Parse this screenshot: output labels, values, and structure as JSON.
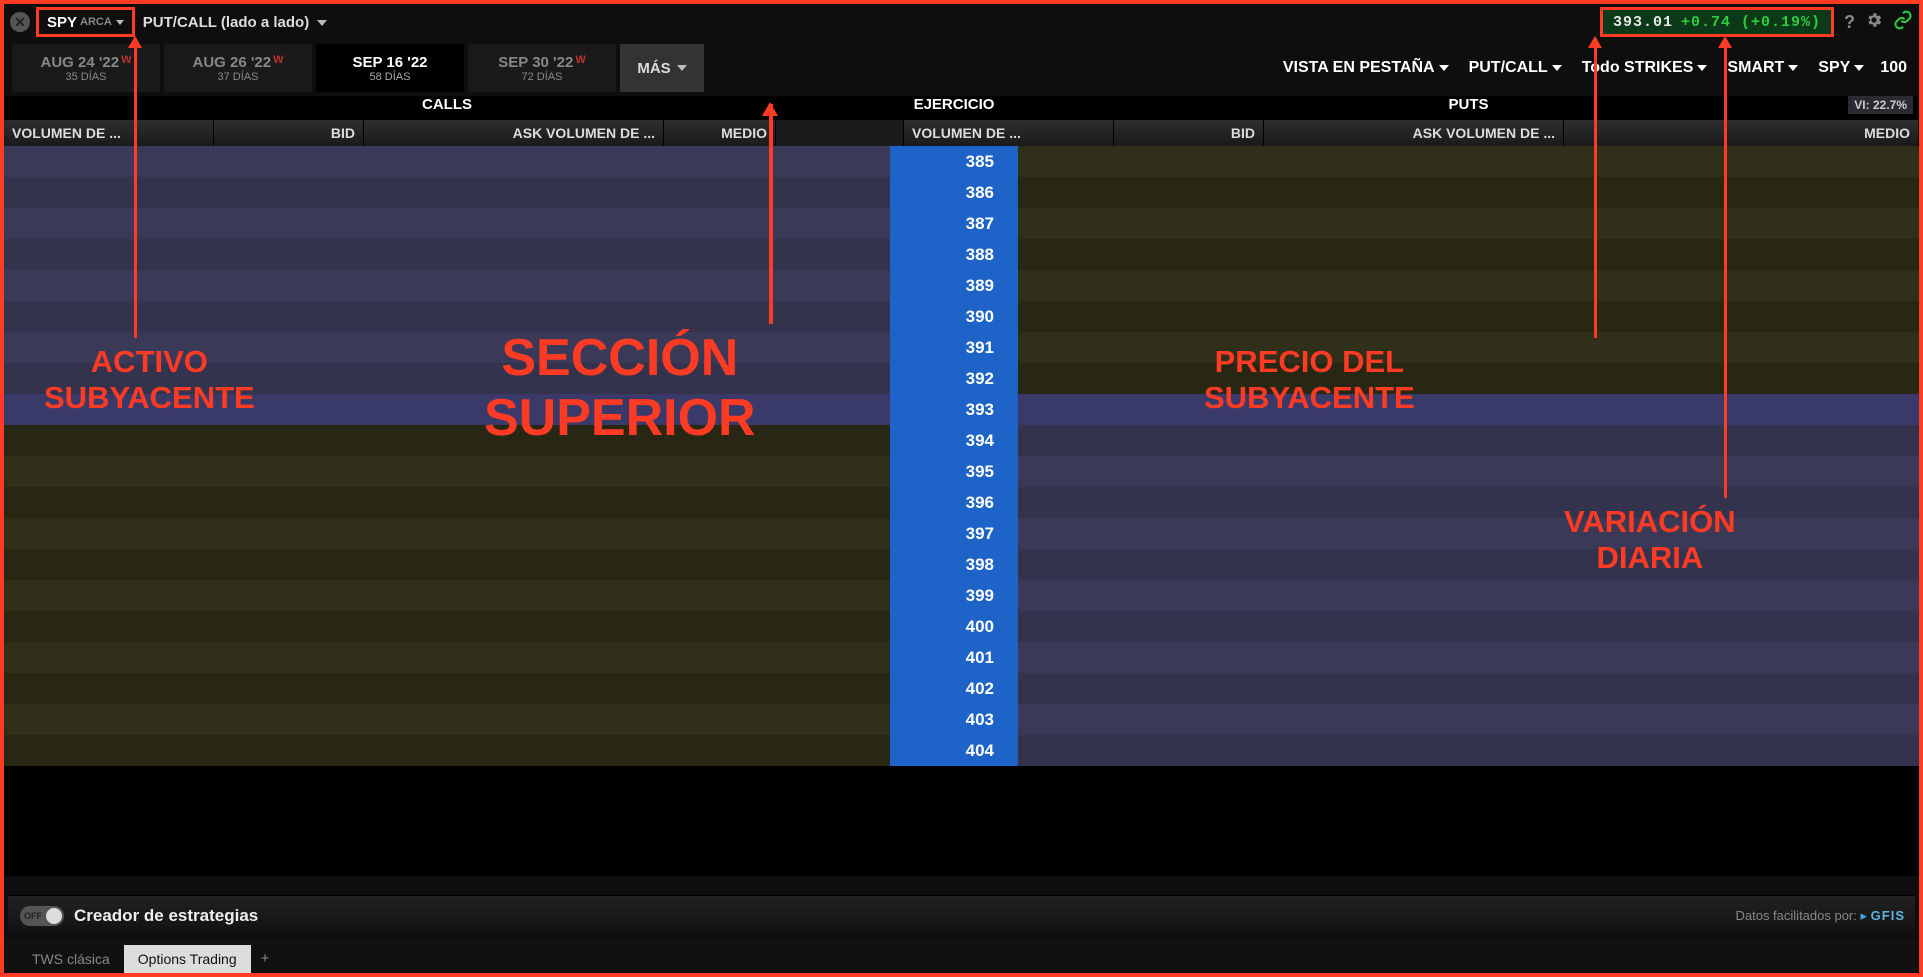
{
  "header": {
    "symbol": "SPY",
    "exchange": "ARCA",
    "view_label": "PUT/CALL (lado a lado)",
    "price_last": "393.01",
    "price_change": "+0.74 (+0.19%)"
  },
  "expirations": [
    {
      "date": "AUG 24 '22",
      "weekly": true,
      "days": "35 DÍAS",
      "active": false
    },
    {
      "date": "AUG 26 '22",
      "weekly": true,
      "days": "37 DÍAS",
      "active": false
    },
    {
      "date": "SEP 16 '22",
      "weekly": false,
      "days": "58 DÍAS",
      "active": true
    },
    {
      "date": "SEP 30 '22",
      "weekly": true,
      "days": "72 DÍAS",
      "active": false
    }
  ],
  "more_label": "MÁS",
  "filters": {
    "view_tab": "VISTA EN PESTAÑA",
    "putcall": "PUT/CALL",
    "strikes": "Todo STRIKES",
    "routing": "SMART",
    "symbol": "SPY",
    "multiplier": "100"
  },
  "sections": {
    "calls": "CALLS",
    "strike_hdr": "EJERCICIO",
    "puts": "PUTS",
    "vi": "VI: 22.7%"
  },
  "columns": {
    "vol": "VOLUMEN DE ...",
    "bid": "BID",
    "askvol": "ASK VOLUMEN DE ...",
    "mid": "MEDIO"
  },
  "strikes": [
    385,
    386,
    387,
    388,
    389,
    390,
    391,
    392,
    393,
    394,
    395,
    396,
    397,
    398,
    399,
    400,
    401,
    402,
    403,
    404
  ],
  "atm_strike": 393,
  "footer": {
    "toggle": "OFF",
    "strategy": "Creador de estrategias",
    "provider_prefix": "Datos facilitados por: ",
    "provider_logo": "GFIS"
  },
  "tabs": [
    {
      "label": "TWS clásica",
      "active": false
    },
    {
      "label": "Options Trading",
      "active": true
    }
  ],
  "annotations": {
    "activo": "ACTIVO\nSUBYACENTE",
    "seccion": "SECCIÓN\nSUPERIOR",
    "precio": "PRECIO DEL\nSUBYACENTE",
    "variacion": "VARIACIÓN\nDIARIA"
  }
}
